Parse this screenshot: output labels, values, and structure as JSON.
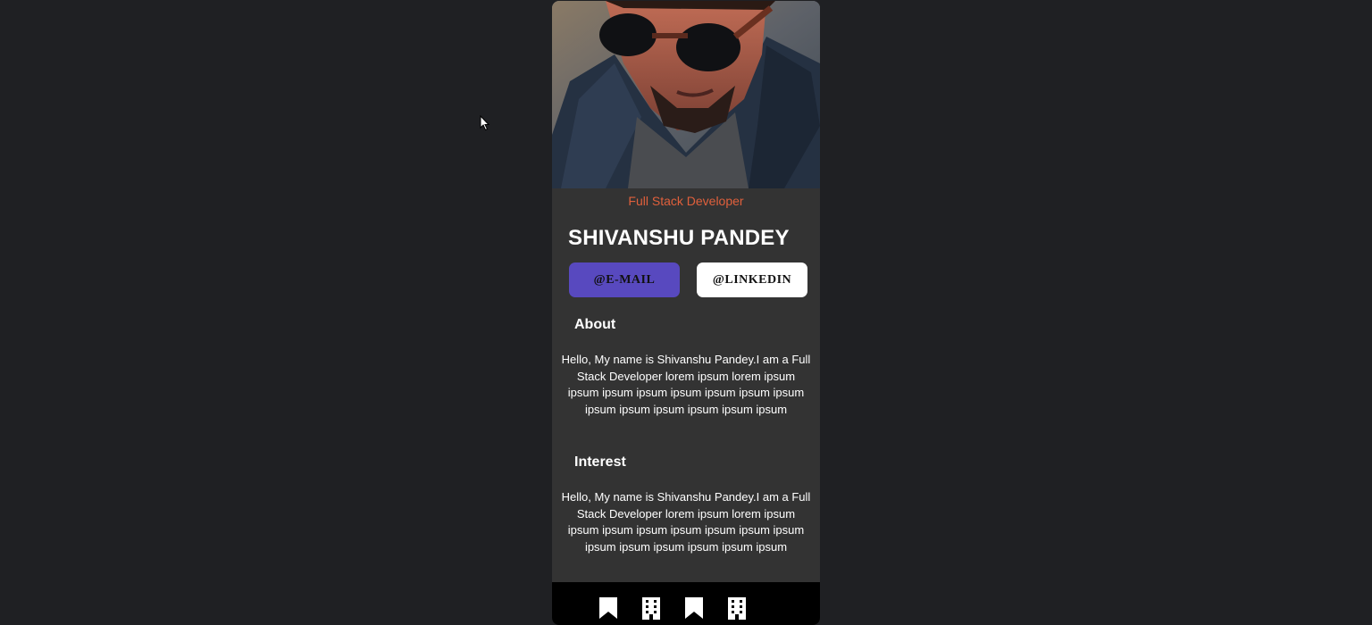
{
  "profile": {
    "role": "Full Stack Developer",
    "name": "SHIVANSHU PANDEY",
    "role_color": "#e0603c"
  },
  "buttons": {
    "email_label": "@E-MAIL",
    "linkedin_label": "@LINKEDIN",
    "email_color": "#5849bf"
  },
  "sections": {
    "about": {
      "title": "About",
      "body": "Hello, My name is Shivanshu Pandey.I am a Full Stack Developer lorem ipsum lorem ipsum ipsum ipsum ipsum ipsum ipsum ipsum ipsum ipsum ipsum ipsum ipsum ipsum ipsum"
    },
    "interest": {
      "title": "Interest",
      "body": "Hello, My name is Shivanshu Pandey.I am a Full Stack Developer lorem ipsum lorem ipsum ipsum ipsum ipsum ipsum ipsum ipsum ipsum ipsum ipsum ipsum ipsum ipsum ipsum"
    }
  },
  "footer": {
    "icons": [
      "bookmark-icon",
      "building-icon",
      "bookmark-icon",
      "building-icon"
    ]
  },
  "colors": {
    "page_background": "#1f2023",
    "card_background": "#333333",
    "footer_background": "#000000"
  }
}
